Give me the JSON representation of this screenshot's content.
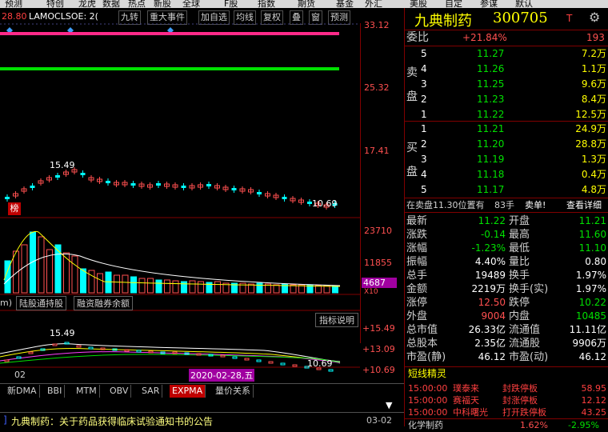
{
  "toolbar": [
    "预测",
    "特创",
    "龙虎",
    "数据",
    "热点",
    "新股",
    "全球",
    "F股",
    "指数",
    "期货",
    "基金",
    "外汇",
    "美股",
    "自定",
    "参谋",
    "默认"
  ],
  "chart_header": {
    "price_label": "28.80",
    "indicator_text": "LAMOCLSOE: 2(",
    "tabs": [
      "九转",
      "重大事件",
      "加自选",
      "均线",
      "复权",
      "叠",
      "窗",
      "预测"
    ]
  },
  "price_axis": [
    "33.12",
    "25.32",
    "17.41"
  ],
  "candle_labels": {
    "high": "15.49",
    "low": "10.69",
    "badge": "榜"
  },
  "volume_axis": [
    "23710",
    "11855"
  ],
  "volume_badge": "4687",
  "volume_unit": "X10",
  "subtabs": [
    "m)",
    "陆股通持股",
    "融资融券余额"
  ],
  "indicator_btn": "指标说明",
  "ind_axis": [
    "+15.49",
    "+13.09",
    "+10.69"
  ],
  "ind_labels": {
    "high": "15.49",
    "low": "10.69"
  },
  "date_label": "02",
  "date_badge": "2020-02-28,五",
  "bottom_tabs": [
    "新DMA",
    "BBI",
    "MTM",
    "OBV",
    "SAR",
    "EXPMA",
    "量价关系"
  ],
  "news": {
    "text": "九典制药：关于药品获得临床试验通知书的公告",
    "date": "03-02"
  },
  "quote": {
    "name": "九典制药",
    "code": "300705",
    "flag": "T",
    "weibi_label": "委比",
    "weibi_value": "+21.84%",
    "weibi_diff": "193",
    "sell_label": "卖盘",
    "buy_label": "买盘",
    "sell": [
      {
        "n": "5",
        "price": "11.27",
        "vol": "7.2万"
      },
      {
        "n": "4",
        "price": "11.26",
        "vol": "1.1万"
      },
      {
        "n": "3",
        "price": "11.25",
        "vol": "9.6万"
      },
      {
        "n": "2",
        "price": "11.23",
        "vol": "8.4万"
      },
      {
        "n": "1",
        "price": "11.22",
        "vol": "12.5万"
      }
    ],
    "buy": [
      {
        "n": "1",
        "price": "11.21",
        "vol": "24.9万"
      },
      {
        "n": "2",
        "price": "11.20",
        "vol": "28.8万"
      },
      {
        "n": "3",
        "price": "11.19",
        "vol": "1.3万"
      },
      {
        "n": "4",
        "price": "11.18",
        "vol": "0.4万"
      },
      {
        "n": "5",
        "price": "11.17",
        "vol": "4.8万"
      }
    ],
    "trade_line": {
      "text": "在卖盘11.30位置有",
      "hands": "83手",
      "action": "卖单!",
      "link": "查看详细"
    },
    "stats": [
      {
        "l1": "最新",
        "v1": "11.22",
        "l2": "开盘",
        "v2": "11.21"
      },
      {
        "l1": "涨跌",
        "v1": "-0.14",
        "l2": "最高",
        "v2": "11.60"
      },
      {
        "l1": "涨幅",
        "v1": "-1.23%",
        "l2": "最低",
        "v2": "11.10"
      },
      {
        "l1": "振幅",
        "v1": "4.40%",
        "l2": "量比",
        "v2": "0.80"
      },
      {
        "l1": "总手",
        "v1": "19489",
        "l2": "换手",
        "v2": "1.97%"
      },
      {
        "l1": "金额",
        "v1": "2219万",
        "l2": "换手(实)",
        "v2": "1.97%"
      },
      {
        "l1": "涨停",
        "v1": "12.50",
        "l2": "跌停",
        "v2": "10.22"
      },
      {
        "l1": "外盘",
        "v1": "9004",
        "l2": "内盘",
        "v2": "10485"
      },
      {
        "l1": "总市值",
        "v1": "26.33亿",
        "l2": "流通值",
        "v2": "11.11亿"
      },
      {
        "l1": "总股本",
        "v1": "2.35亿",
        "l2": "流通股",
        "v2": "9906万"
      },
      {
        "l1": "市盈(静)",
        "v1": "46.12",
        "l2": "市盈(动)",
        "v2": "46.12"
      }
    ],
    "sprite_title": "短线精灵",
    "sprites": [
      {
        "time": "15:00:00",
        "name": "璞泰来",
        "event": "封跌停板",
        "val": "58.95"
      },
      {
        "time": "15:00:00",
        "name": "赛福天",
        "event": "封涨停板",
        "val": "12.12"
      },
      {
        "time": "15:00:00",
        "name": "中科曙光",
        "event": "打开跌停板",
        "val": "43.25"
      }
    ],
    "bottom_line": {
      "name": "化学制药",
      "val": "1.62%",
      "val2": "-2.95%"
    }
  },
  "colors": {
    "red": "#ff5050",
    "green": "#00e000",
    "cyan": "#00ffff",
    "yellow": "#ffff00",
    "magenta": "#ff2a8a"
  }
}
